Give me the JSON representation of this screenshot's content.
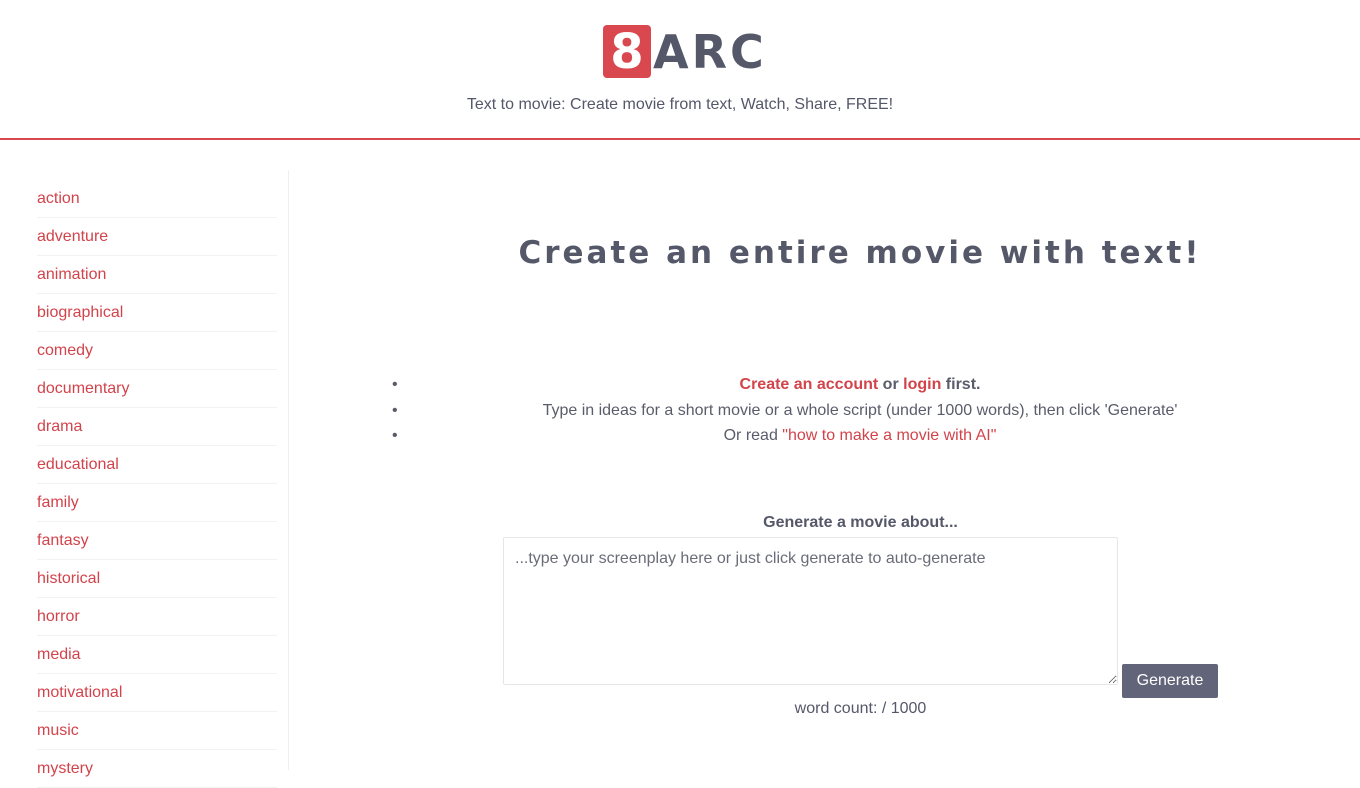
{
  "header": {
    "logo_mark": "8",
    "logo_text": "ARC",
    "tagline": "Text to movie: Create movie from text, Watch, Share, FREE!",
    "accent_color": "#d9484f"
  },
  "sidebar": {
    "genres": [
      {
        "label": "action"
      },
      {
        "label": "adventure"
      },
      {
        "label": "animation"
      },
      {
        "label": "biographical"
      },
      {
        "label": "comedy"
      },
      {
        "label": "documentary"
      },
      {
        "label": "drama"
      },
      {
        "label": "educational"
      },
      {
        "label": "family"
      },
      {
        "label": "fantasy"
      },
      {
        "label": "historical"
      },
      {
        "label": "horror"
      },
      {
        "label": "media"
      },
      {
        "label": "motivational"
      },
      {
        "label": "music"
      },
      {
        "label": "mystery"
      }
    ]
  },
  "main": {
    "title": "Create an entire movie with text!",
    "instructions": {
      "create_account_link": "Create an account",
      "or_text": " or ",
      "login_link": "login",
      "first_text": " first.",
      "line2": "Type in ideas for a short movie or a whole script (under 1000 words), then click 'Generate'",
      "line3_prefix": "Or read ",
      "howto_link": "\"how to make a movie with AI\""
    },
    "generate_label": "Generate a movie about...",
    "screenplay_placeholder": "...type your screenplay here or just click generate to auto-generate",
    "screenplay_value": "",
    "generate_button": "Generate",
    "word_count": "word count: / 1000"
  }
}
